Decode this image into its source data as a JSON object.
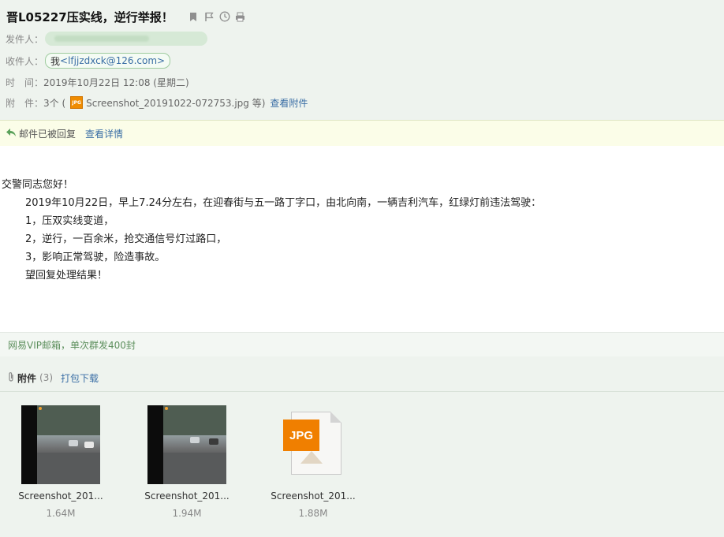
{
  "header": {
    "subject": "晋L05227压实线，逆行举报！",
    "icons": [
      "bookmark-icon",
      "flag-icon",
      "clock-icon",
      "print-icon"
    ],
    "from_label": "发件人：",
    "to_label": "收件人：",
    "to_me": "我",
    "to_address": "<lfjjzdxck@126.com>",
    "time_label": "时　间：",
    "time_value": "2019年10月22日 12:08 (星期二)",
    "attach_label": "附　件：",
    "attach_count": "3个 (",
    "attach_first": "Screenshot_20191022-072753.jpg 等)",
    "attach_view": "查看附件"
  },
  "reply_bar": {
    "status": "邮件已被回复",
    "detail": "查看详情"
  },
  "body": {
    "greeting": "交警同志您好！",
    "lines": [
      "2019年10月22日，早上7.24分左右，在迎春街与五一路丁字口，由北向南，一辆吉利汽车，红绿灯前违法驾驶：",
      "1，压双实线变道，",
      "2，逆行，一百余米，抢交通信号灯过路口，",
      "3，影响正常驾驶，险造事故。",
      "望回复处理结果！"
    ]
  },
  "signature": "网易VIP邮箱，单次群发400封",
  "attachments": {
    "title": "附件",
    "count": "(3)",
    "download": "打包下载",
    "items": [
      {
        "name": "Screenshot_201...",
        "size": "1.64M",
        "kind": "photo"
      },
      {
        "name": "Screenshot_201...",
        "size": "1.94M",
        "kind": "photo"
      },
      {
        "name": "Screenshot_201...",
        "size": "1.88M",
        "kind": "jpg"
      }
    ],
    "jpg_badge": "JPG"
  },
  "colors": {
    "header_bg": "#eef3ee",
    "link": "#3a6ea5",
    "reply_bar_bg": "#fbfde8",
    "jpg_orange": "#f07f00"
  }
}
